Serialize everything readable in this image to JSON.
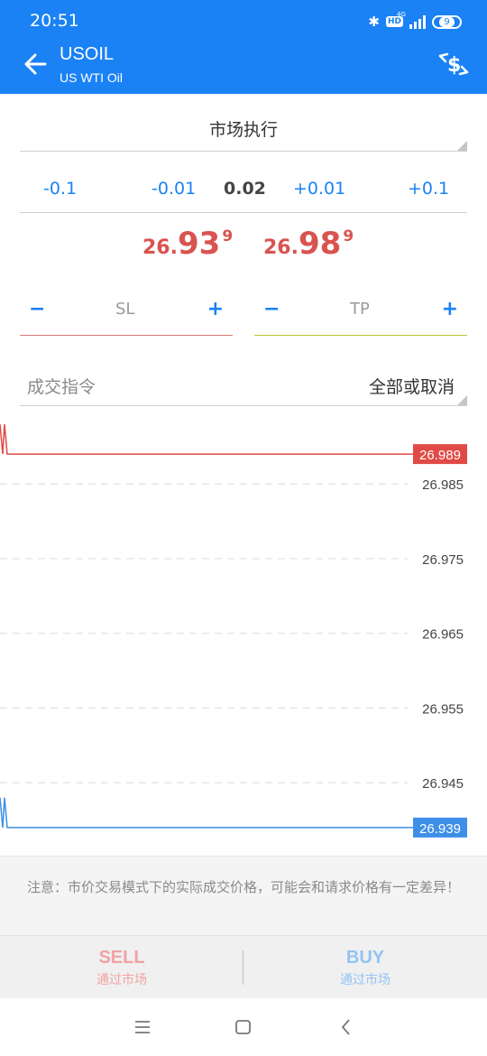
{
  "status_bar": {
    "time": "20:51",
    "network_type": "4G",
    "hd_label": "HD",
    "battery_level": "9"
  },
  "app_bar": {
    "symbol": "USOIL",
    "description": "US WTI Oil"
  },
  "order_form": {
    "execution_mode": "市场执行",
    "volume_buttons": [
      "-0.1",
      "-0.01",
      "+0.01",
      "+0.1"
    ],
    "volume": "0.02",
    "sell_price": {
      "prefix": "26.",
      "big": "93",
      "sup": "9"
    },
    "buy_price": {
      "prefix": "26.",
      "big": "98",
      "sup": "9"
    },
    "sl": {
      "label": "SL",
      "minus": "−",
      "plus": "+"
    },
    "tp": {
      "label": "TP",
      "minus": "−",
      "plus": "+"
    },
    "fill_policy_label": "成交指令",
    "fill_policy_value": "全部或取消"
  },
  "chart_data": {
    "type": "line",
    "ylim": [
      26.935,
      26.993
    ],
    "gridlines": [
      26.985,
      26.975,
      26.965,
      26.955,
      26.945
    ],
    "gridline_labels": [
      "26.985",
      "26.975",
      "26.965",
      "26.955",
      "26.945"
    ],
    "series": [
      {
        "name": "",
        "color": "#e04a46",
        "values": [
          26.993,
          26.989,
          26.993,
          26.989,
          26.989,
          26.989
        ],
        "current_label": "26.989"
      },
      {
        "name": "",
        "color": "#3d8fe8",
        "values": [
          26.943,
          26.939,
          26.943,
          26.939,
          26.939,
          26.939
        ],
        "current_label": "26.939"
      }
    ]
  },
  "notice": "注意：市价交易模式下的实际成交价格，可能会和请求价格有一定差异！",
  "trade": {
    "sell_label": "SELL",
    "sell_sub": "通过市场",
    "buy_label": "BUY",
    "buy_sub": "通过市场"
  },
  "colors": {
    "primary": "#1a82f5",
    "sell": "#d9534f",
    "buy": "#3d8fe8"
  },
  "nav_icons": [
    "menu-icon",
    "home-icon",
    "back-icon"
  ]
}
